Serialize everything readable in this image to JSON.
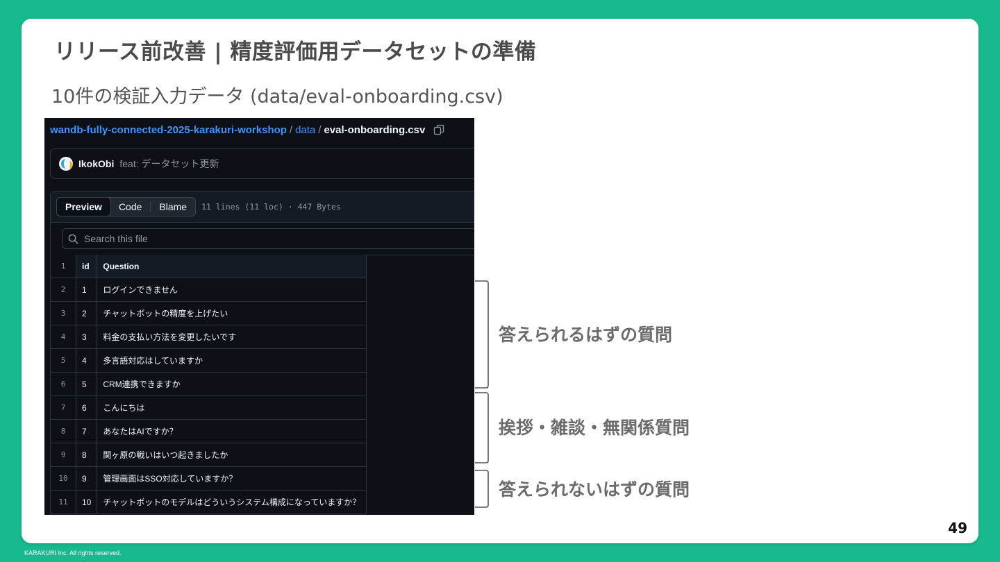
{
  "slide": {
    "title": "リリース前改善 | 精度評価用データセットの準備",
    "subtitle": "10件の検証入力データ (data/eval-onboarding.csv)",
    "page_number": "49",
    "copyright": "KARAKURI Inc. All rights reserved."
  },
  "github": {
    "breadcrumb": {
      "repo": "wandb-fully-connected-2025-karakuri-workshop",
      "sep": "/",
      "folder": "data",
      "file": "eval-onboarding.csv"
    },
    "commit": {
      "author": "IkokObi",
      "message": "feat: データセット更新"
    },
    "tabs": [
      "Preview",
      "Code",
      "Blame"
    ],
    "active_tab": "Preview",
    "file_meta": "11 lines (11 loc) · 447 Bytes",
    "search_placeholder": "Search this file",
    "table": {
      "header": {
        "line": "1",
        "id": "id",
        "question": "Question"
      },
      "rows": [
        {
          "line": "2",
          "id": "1",
          "question": "ログインできません"
        },
        {
          "line": "3",
          "id": "2",
          "question": "チャットボットの精度を上げたい"
        },
        {
          "line": "4",
          "id": "3",
          "question": "料金の支払い方法を変更したいです"
        },
        {
          "line": "5",
          "id": "4",
          "question": "多言語対応はしていますか"
        },
        {
          "line": "6",
          "id": "5",
          "question": "CRM連携できますか"
        },
        {
          "line": "7",
          "id": "6",
          "question": "こんにちは"
        },
        {
          "line": "8",
          "id": "7",
          "question": "あなたはAIですか？"
        },
        {
          "line": "9",
          "id": "8",
          "question": "関ヶ原の戦いはいつ起きましたか"
        },
        {
          "line": "10",
          "id": "9",
          "question": "管理画面はSSO対応していますか？"
        },
        {
          "line": "11",
          "id": "10",
          "question": "チャットボットのモデルはどういうシステム構成になっていますか？"
        }
      ]
    }
  },
  "groups": [
    {
      "label": "答えられるはずの質問"
    },
    {
      "label": "挨拶・雑談・無関係質問"
    },
    {
      "label": "答えられないはずの質問"
    }
  ],
  "colors": {
    "background": "#19b98f",
    "panel": "#0d1117",
    "link": "#4493f8"
  }
}
